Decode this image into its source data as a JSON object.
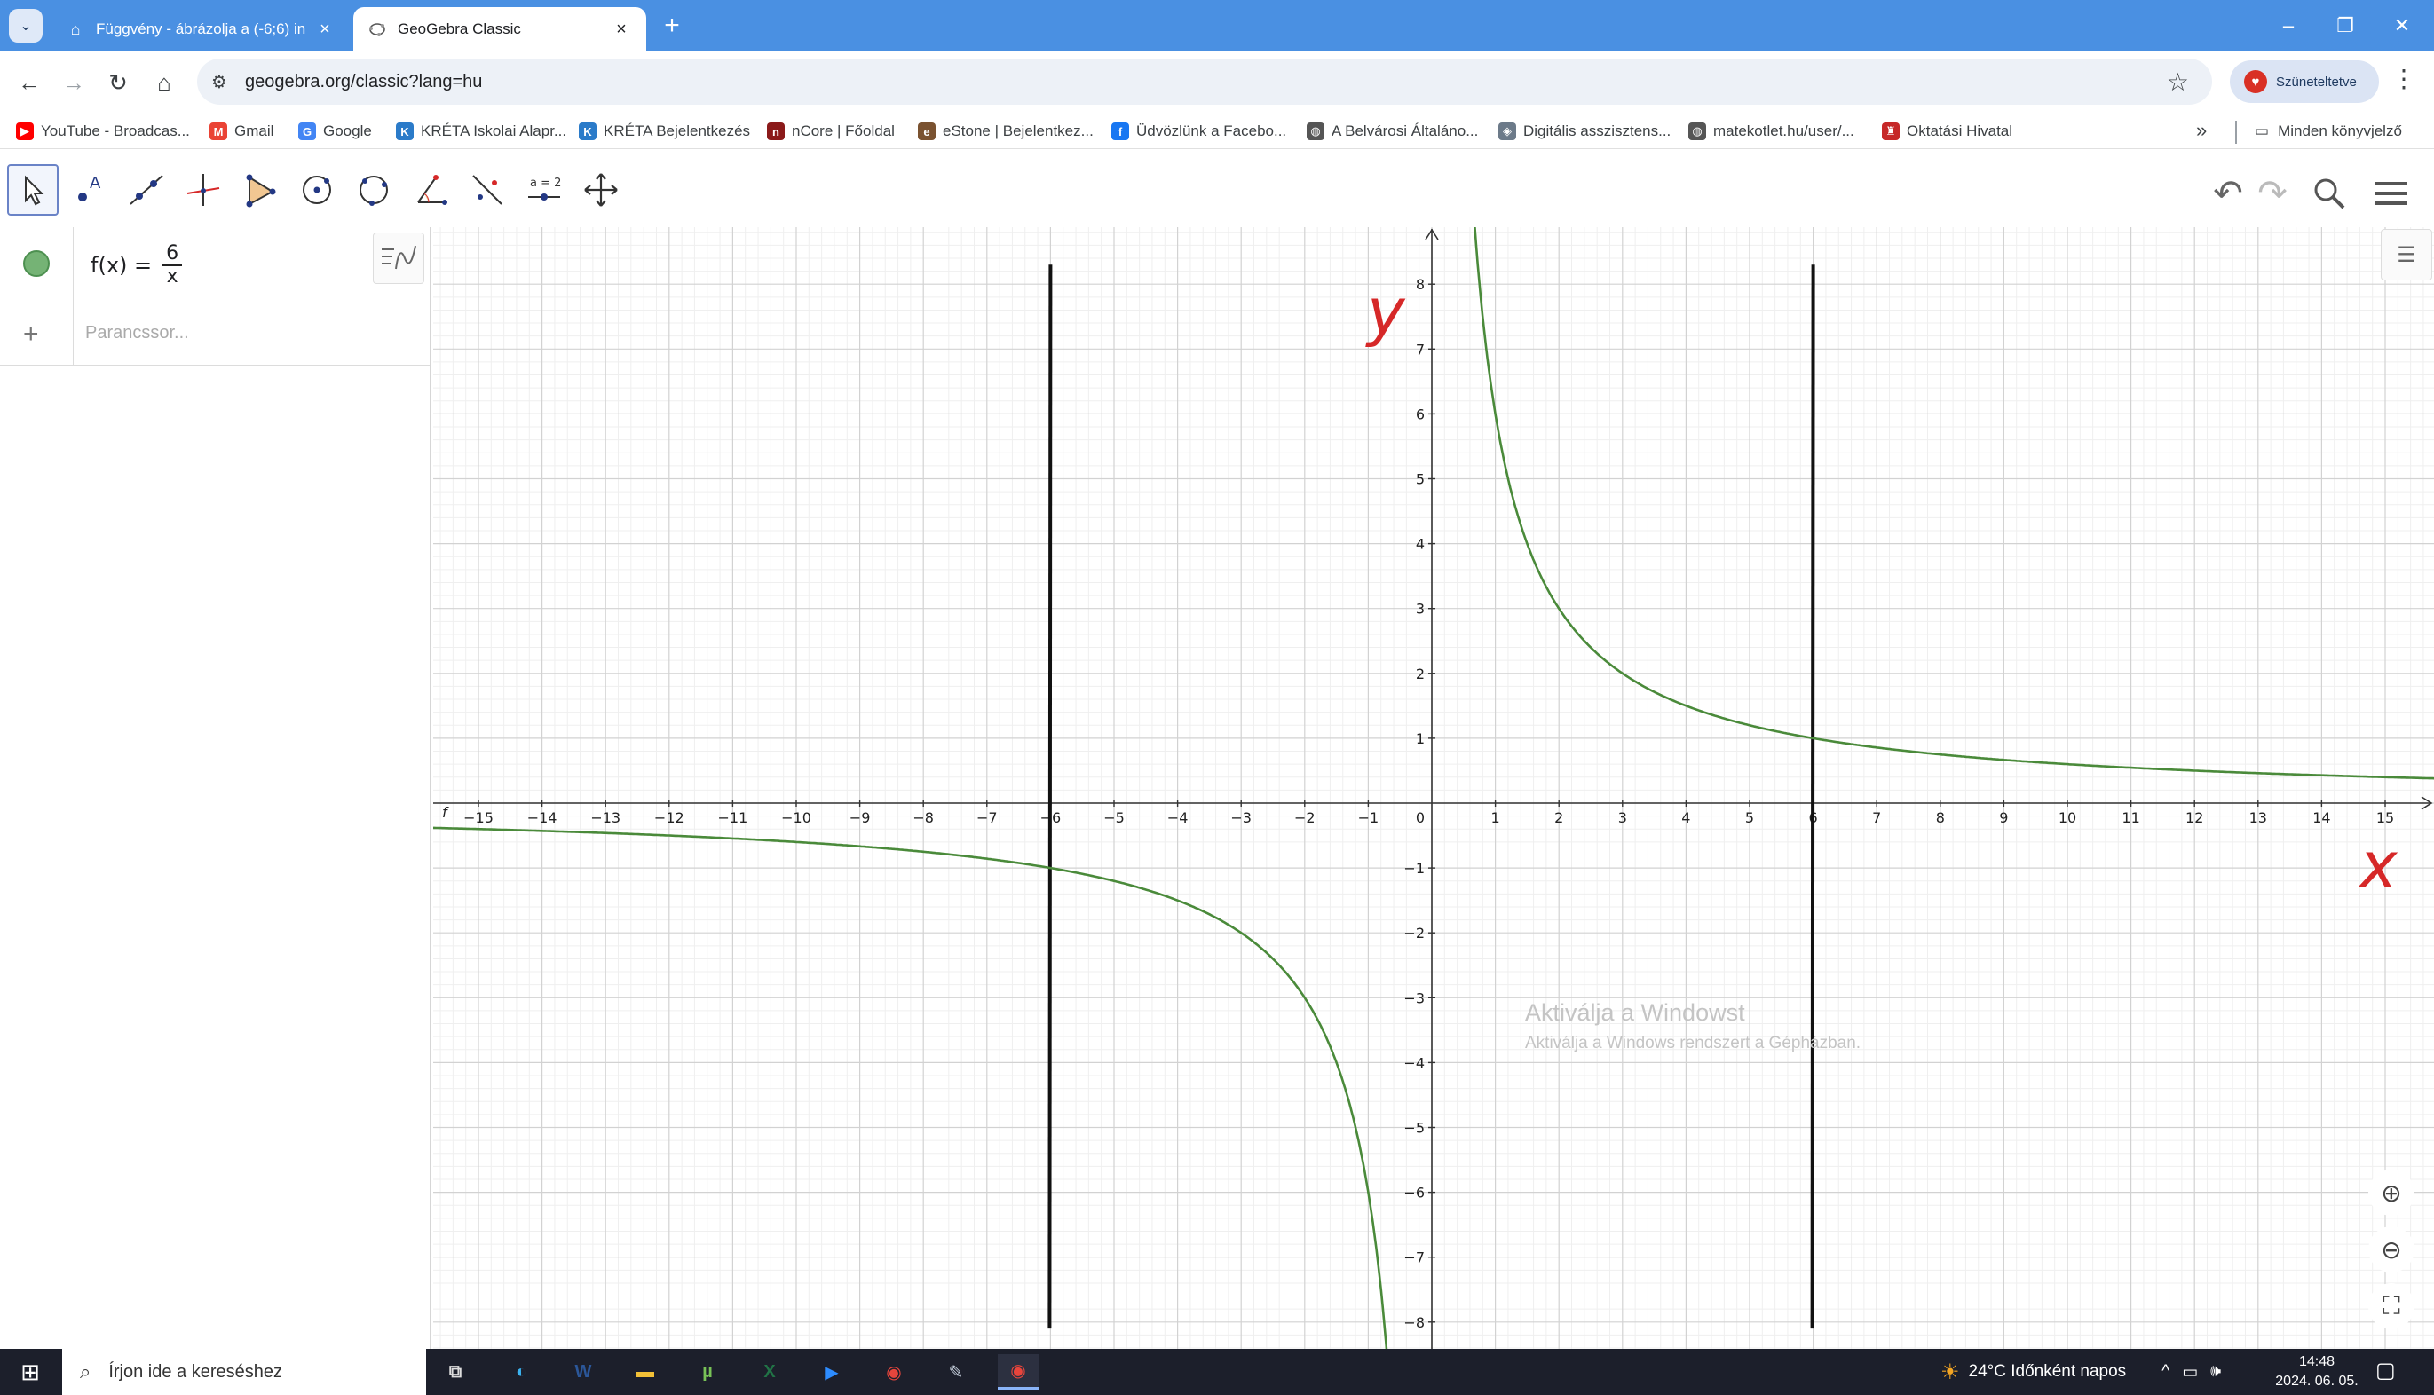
{
  "browser": {
    "tabs": [
      {
        "title": "Függvény - ábrázolja a (-6;6) in",
        "active": false
      },
      {
        "title": "GeoGebra Classic",
        "active": true
      }
    ],
    "new_tab": "+",
    "url": "geogebra.org/classic?lang=hu",
    "paused_label": "Szüneteltetve",
    "window_controls": {
      "minimize": "–",
      "restore": "❐",
      "close": "✕"
    },
    "bookmarks": [
      {
        "label": "YouTube - Broadcas...",
        "icon": "youtube-icon",
        "color": "#ff0000"
      },
      {
        "label": "Gmail",
        "icon": "gmail-icon",
        "color": "#ea4335"
      },
      {
        "label": "Google",
        "icon": "google-icon",
        "color": "#4285f4"
      },
      {
        "label": "KRÉTA Iskolai Alapr...",
        "icon": "kreta-icon",
        "color": "#2b7bc9"
      },
      {
        "label": "KRÉTA Bejelentkezés",
        "icon": "kreta-icon",
        "color": "#2b7bc9"
      },
      {
        "label": "nCore | Főoldal",
        "icon": "ncore-icon",
        "color": "#8b1a1a"
      },
      {
        "label": "eStone | Bejelentkez...",
        "icon": "estone-icon",
        "color": "#7a5230"
      },
      {
        "label": "Üdvözlünk a Facebo...",
        "icon": "facebook-icon",
        "color": "#1877f2"
      },
      {
        "label": "A Belvárosi Általáno...",
        "icon": "globe-icon",
        "color": "#555555"
      },
      {
        "label": "Digitális asszisztens...",
        "icon": "shield-icon",
        "color": "#6c7a89"
      },
      {
        "label": "matekotlet.hu/user/...",
        "icon": "globe-icon",
        "color": "#555555"
      },
      {
        "label": "Oktatási Hivatal",
        "icon": "oktatasi-icon",
        "color": "#c62828"
      }
    ],
    "bookmarks_more": "»",
    "all_bookmarks": "Minden könyvjelző"
  },
  "geogebra": {
    "tools": [
      "move-tool",
      "point-tool",
      "line-tool",
      "perpendicular-tool",
      "polygon-tool",
      "circle-center-tool",
      "circle-three-points-tool",
      "angle-tool",
      "reflect-tool",
      "slider-tool",
      "move-graphics-tool"
    ],
    "slider_tool_text": "a = 2",
    "algebra": {
      "function_name": "f(x) =",
      "numerator": "6",
      "denominator": "x",
      "input_placeholder": "Parancssor..."
    },
    "graph": {
      "function_label": "f",
      "x_axis_label": "x",
      "y_axis_label": "y",
      "curve_color": "#4a8a3a",
      "annotation_color": "#d62828",
      "vertical_lines_x": [
        -6,
        6
      ],
      "x_range": [
        -15.6,
        15.7
      ],
      "y_range": [
        -8.6,
        8.7
      ]
    },
    "watermark_line1": "Aktiválja a Windowst",
    "watermark_line2": "Aktiválja a Windows rendszert a Gépházban."
  },
  "taskbar": {
    "search_placeholder": "Írjon ide a kereséshez",
    "weather": "24°C  Időnként napos",
    "time": "14:48",
    "date": "2024. 06. 05."
  }
}
